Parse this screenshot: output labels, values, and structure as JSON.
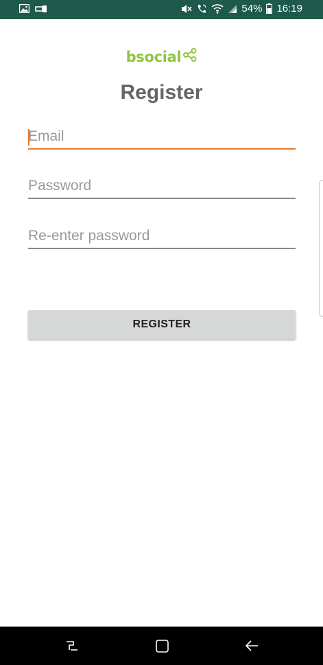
{
  "status_bar": {
    "battery_percent": "54%",
    "time": "16:19",
    "left_icons": [
      "image-icon",
      "key-icon"
    ],
    "right_icons": [
      "mute-icon",
      "call-icon",
      "wifi-icon",
      "signal-icon",
      "battery-icon"
    ]
  },
  "logo": {
    "text": "bsocial",
    "icon": "share-icon",
    "color": "#8dc63f"
  },
  "page": {
    "title": "Register"
  },
  "form": {
    "email_placeholder": "Email",
    "email_value": "",
    "password_placeholder": "Password",
    "password_value": "",
    "reenter_placeholder": "Re-enter password",
    "reenter_value": "",
    "focused_field": "email",
    "focus_color": "#e8772e"
  },
  "register_button": {
    "label": "REGISTER"
  },
  "nav_bar": {
    "items": [
      "recent-apps-icon",
      "home-icon",
      "back-icon"
    ]
  }
}
